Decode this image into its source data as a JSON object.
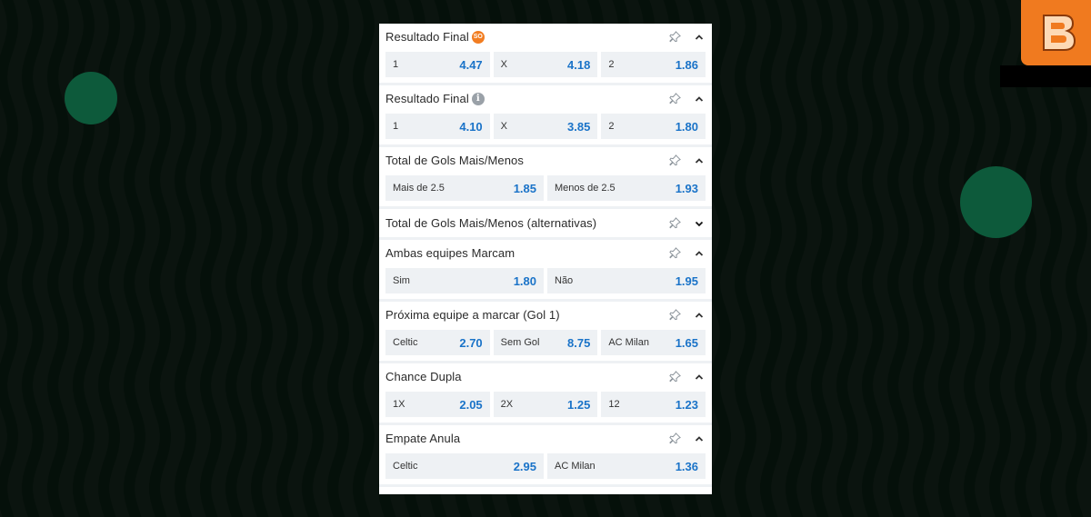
{
  "brand": {
    "accent": "#f07a1f",
    "odd_color": "#1a73c8"
  },
  "markets": [
    {
      "title": "Resultado Final",
      "badge": "SO",
      "info": false,
      "expanded": true,
      "odds": [
        {
          "label": "1",
          "value": "4.47"
        },
        {
          "label": "X",
          "value": "4.18"
        },
        {
          "label": "2",
          "value": "1.86"
        }
      ]
    },
    {
      "title": "Resultado Final",
      "badge": "",
      "info": true,
      "expanded": true,
      "odds": [
        {
          "label": "1",
          "value": "4.10"
        },
        {
          "label": "X",
          "value": "3.85"
        },
        {
          "label": "2",
          "value": "1.80"
        }
      ]
    },
    {
      "title": "Total de Gols Mais/Menos",
      "badge": "",
      "info": false,
      "expanded": true,
      "odds": [
        {
          "label": "Mais de 2.5",
          "value": "1.85"
        },
        {
          "label": "Menos de 2.5",
          "value": "1.93"
        }
      ]
    },
    {
      "title": "Total de Gols Mais/Menos (alternativas)",
      "badge": "",
      "info": false,
      "expanded": false,
      "odds": []
    },
    {
      "title": "Ambas equipes Marcam",
      "badge": "",
      "info": false,
      "expanded": true,
      "odds": [
        {
          "label": "Sim",
          "value": "1.80"
        },
        {
          "label": "Não",
          "value": "1.95"
        }
      ]
    },
    {
      "title": "Próxima equipe a marcar (Gol 1)",
      "badge": "",
      "info": false,
      "expanded": true,
      "odds": [
        {
          "label": "Celtic",
          "value": "2.70"
        },
        {
          "label": "Sem Gol",
          "value": "8.75"
        },
        {
          "label": "AC Milan",
          "value": "1.65"
        }
      ]
    },
    {
      "title": "Chance Dupla",
      "badge": "",
      "info": false,
      "expanded": true,
      "odds": [
        {
          "label": "1X",
          "value": "2.05"
        },
        {
          "label": "2X",
          "value": "1.25"
        },
        {
          "label": "12",
          "value": "1.23"
        }
      ]
    },
    {
      "title": "Empate Anula",
      "badge": "",
      "info": false,
      "expanded": true,
      "odds": [
        {
          "label": "Celtic",
          "value": "2.95"
        },
        {
          "label": "AC Milan",
          "value": "1.36"
        }
      ]
    }
  ]
}
